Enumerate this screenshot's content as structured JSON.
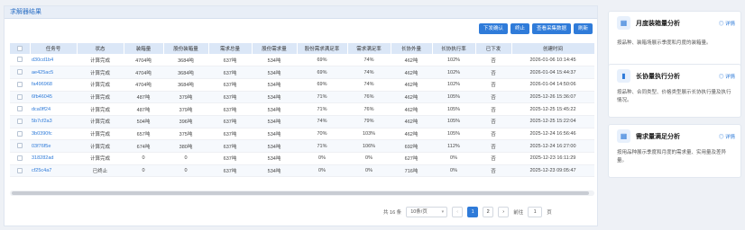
{
  "panel": {
    "title": "求解器结果"
  },
  "toolbar": {
    "buttons": [
      "下发确认",
      "终止",
      "查看采集数据",
      "刷新"
    ]
  },
  "table": {
    "headers": [
      "任务号",
      "状态",
      "装箱量",
      "股份装箱量",
      "需求总量",
      "股份需求量",
      "股份需求满足率",
      "需求满足率",
      "长协外量",
      "长协执行率",
      "已下发",
      "创建时间"
    ],
    "rows": [
      [
        "d30cd1b4",
        "计算完成",
        "4704吨",
        "3684吨",
        "637吨",
        "534吨",
        "69%",
        "74%",
        "462吨",
        "102%",
        "否",
        "2026-01-06 10:14:45"
      ],
      [
        "ae425ac5",
        "计算完成",
        "4704吨",
        "3684吨",
        "637吨",
        "534吨",
        "69%",
        "74%",
        "462吨",
        "102%",
        "否",
        "2026-01-04 15:44:37"
      ],
      [
        "fa496968",
        "计算完成",
        "4704吨",
        "3684吨",
        "637吨",
        "534吨",
        "69%",
        "74%",
        "462吨",
        "102%",
        "否",
        "2026-01-04 14:50:06"
      ],
      [
        "6fb46045",
        "计算完成",
        "487吨",
        "379吨",
        "637吨",
        "534吨",
        "71%",
        "76%",
        "462吨",
        "105%",
        "否",
        "2025-12-26 15:36:07"
      ],
      [
        "dca0ff24",
        "计算完成",
        "487吨",
        "379吨",
        "637吨",
        "534吨",
        "71%",
        "76%",
        "462吨",
        "105%",
        "否",
        "2025-12-25 15:45:22"
      ],
      [
        "5b7cf2a3",
        "计算完成",
        "504吨",
        "396吨",
        "637吨",
        "534吨",
        "74%",
        "79%",
        "462吨",
        "105%",
        "否",
        "2025-12-25 15:22:04"
      ],
      [
        "3b0390fc",
        "计算完成",
        "657吨",
        "375吨",
        "637吨",
        "534吨",
        "70%",
        "103%",
        "462吨",
        "105%",
        "否",
        "2025-12-24 16:56:46"
      ],
      [
        "03f76f5e",
        "计算完成",
        "674吨",
        "380吨",
        "637吨",
        "534吨",
        "71%",
        "106%",
        "692吨",
        "112%",
        "否",
        "2025-12-24 16:27:00"
      ],
      [
        "318282ad",
        "计算完成",
        "0",
        "0",
        "637吨",
        "534吨",
        "0%",
        "0%",
        "627吨",
        "0%",
        "否",
        "2025-12-23 16:11:29"
      ],
      [
        "cf25c4a7",
        "已终止",
        "0",
        "0",
        "637吨",
        "534吨",
        "0%",
        "0%",
        "716吨",
        "0%",
        "否",
        "2025-12-23 09:05:47"
      ]
    ]
  },
  "pager": {
    "total": "共 16 条",
    "page_size": "10条/页",
    "pages": [
      "1",
      "2"
    ],
    "goto_label": "前往",
    "goto_value": "1",
    "page_unit": "页",
    "prev": "‹",
    "next": "›"
  },
  "cards": [
    {
      "icon": "calendar-icon",
      "glyph": "▦",
      "title": "月度装箱量分析",
      "link": "◎ 详情",
      "desc": "按品种、装箱场展示季度和月度的装箱量。"
    },
    {
      "icon": "bar-chart-icon",
      "glyph": "▮",
      "title": "长协量执行分析",
      "link": "◎ 详情",
      "desc": "按品种、合同类型、价格类型展示长协执行量及执行情况。"
    },
    {
      "icon": "calendar-icon",
      "glyph": "▦",
      "title": "需求量满足分析",
      "link": "◎ 详情",
      "desc": "按用品种展示季度和月度的需求量、实用量及差异量。"
    }
  ]
}
